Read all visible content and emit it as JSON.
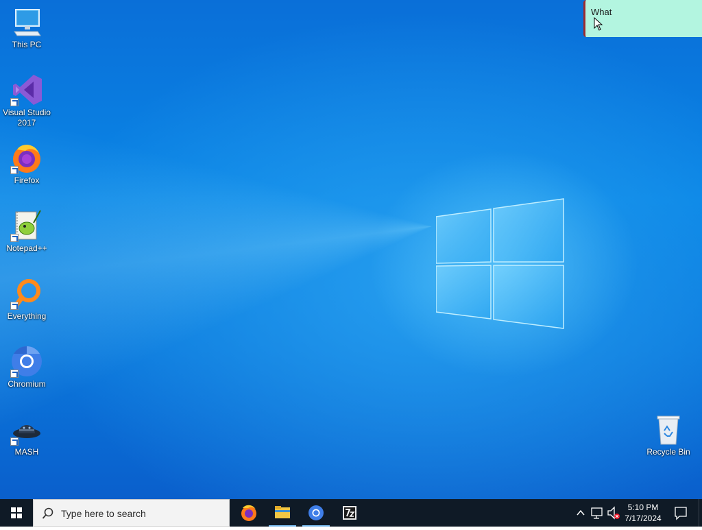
{
  "desktop": {
    "icons": [
      {
        "label_line1": "This PC",
        "label_line2": ""
      },
      {
        "label_line1": "Visual Studio",
        "label_line2": "2017"
      },
      {
        "label_line1": "Firefox",
        "label_line2": ""
      },
      {
        "label_line1": "Notepad++",
        "label_line2": ""
      },
      {
        "label_line1": "Everything",
        "label_line2": ""
      },
      {
        "label_line1": "Chromium",
        "label_line2": ""
      },
      {
        "label_line1": "MASH",
        "label_line2": ""
      },
      {
        "label_line1": "Recycle Bin",
        "label_line2": ""
      }
    ]
  },
  "sticky_note": {
    "text": "What"
  },
  "taskbar": {
    "search_placeholder": "Type here to search",
    "pinned": [
      "firefox-icon",
      "file-explorer-icon",
      "chromium-icon",
      "7zip-icon"
    ],
    "clock": {
      "time": "5:10 PM",
      "date": "7/17/2024"
    }
  },
  "colors": {
    "desktop_blue": "#0a78dc",
    "taskbar_bg": "#0f1a26",
    "sticky_bg": "#b3f5e0",
    "sticky_edge": "#9b2b30"
  }
}
